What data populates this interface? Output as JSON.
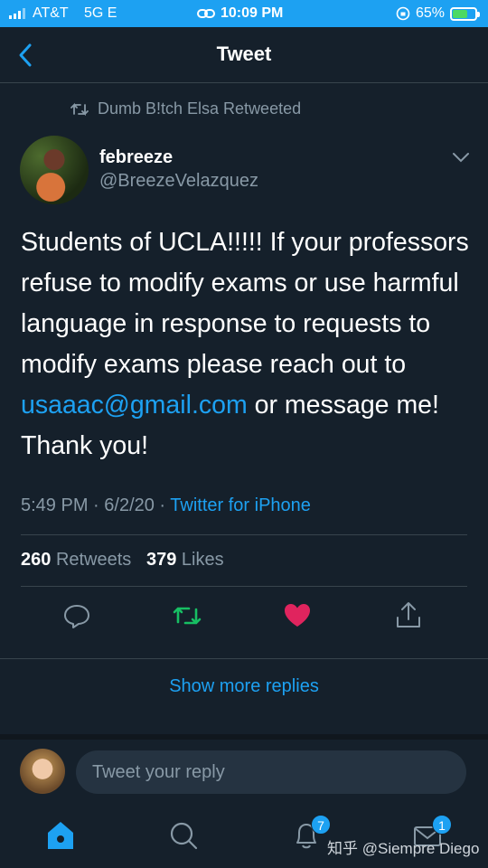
{
  "status": {
    "carrier": "AT&T",
    "network": "5G E",
    "time": "10:09 PM",
    "battery": "65%",
    "battery_level": 0.65
  },
  "nav": {
    "title": "Tweet"
  },
  "retweet_label": "Dumb B!tch Elsa Retweeted",
  "author": {
    "name": "febreeze",
    "handle": "@BreezeVelazquez"
  },
  "tweet": {
    "text_before": "Students of UCLA!!!!! If your professors refuse to modify exams or use harmful language in response to requests to modify exams please reach out to ",
    "link": "usaaac@gmail.com",
    "text_after": " or message me! Thank you!",
    "time": "5:49 PM",
    "date": "6/2/20",
    "source": "Twitter for iPhone",
    "retweets": "260",
    "retweets_label": "Retweets",
    "likes": "379",
    "likes_label": "Likes"
  },
  "show_more": "Show more replies",
  "reply": {
    "placeholder": "Tweet your reply"
  },
  "tabs": {
    "notifications_badge": "7",
    "messages_badge": "1"
  },
  "watermark": "知乎 @Siempre Diego",
  "colors": {
    "accent": "#1da1f2",
    "like": "#e0245e",
    "retweet": "#17bf63",
    "background": "#15202b"
  }
}
